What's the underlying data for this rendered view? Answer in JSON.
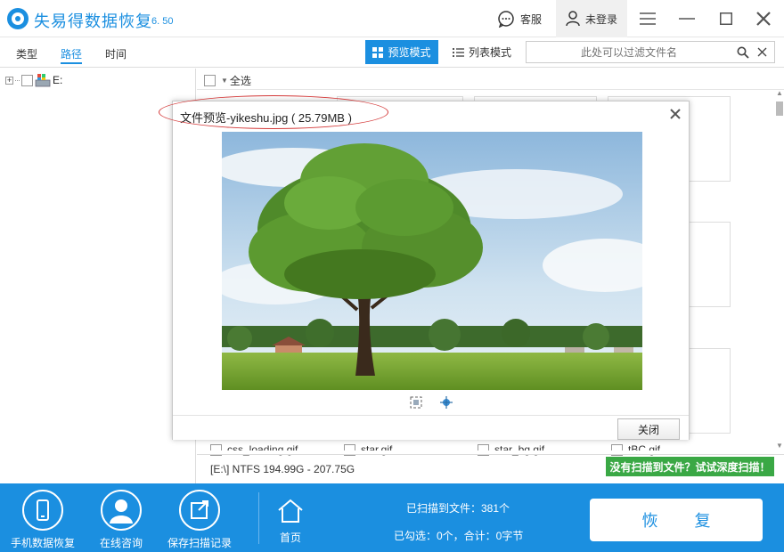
{
  "app": {
    "title": "失易得数据恢复",
    "version": "6. 50"
  },
  "header": {
    "service_label": "客服",
    "login_label": "未登录"
  },
  "tabs": [
    {
      "label": "类型"
    },
    {
      "label": "路径"
    },
    {
      "label": "时间"
    }
  ],
  "active_tab": "路径",
  "view_modes": {
    "preview": "预览模式",
    "list": "列表模式"
  },
  "filter": {
    "placeholder": "此处可以过滤文件名"
  },
  "tree": {
    "drive_label": "E:"
  },
  "content": {
    "select_all_label": "全选",
    "files": [
      {
        "name": "css_loading.gif"
      },
      {
        "name": "star.gif"
      },
      {
        "name": "star_bg.gif"
      },
      {
        "name": "tBC.gif"
      }
    ],
    "status_text": "[E:\\] NTFS 194.99G - 207.75G",
    "deep_scan_label": "没有扫描到文件？试试深度扫描！"
  },
  "preview_dialog": {
    "title": "文件预览-yikeshu.jpg ( 25.79MB )",
    "close_button_label": "关闭"
  },
  "bottom": {
    "items": [
      {
        "label": "手机数据恢复"
      },
      {
        "label": "在线咨询"
      },
      {
        "label": "保存扫描记录"
      },
      {
        "label": "首页"
      }
    ],
    "scanned_text": "已扫描到文件：381个",
    "selected_text": "已勾选：0个，合计：0字节",
    "recover_label": "恢 复"
  },
  "colors": {
    "accent": "#1b8fe0",
    "deep_scan": "#3aa845",
    "highlight_ellipse": "#d43a3a"
  }
}
